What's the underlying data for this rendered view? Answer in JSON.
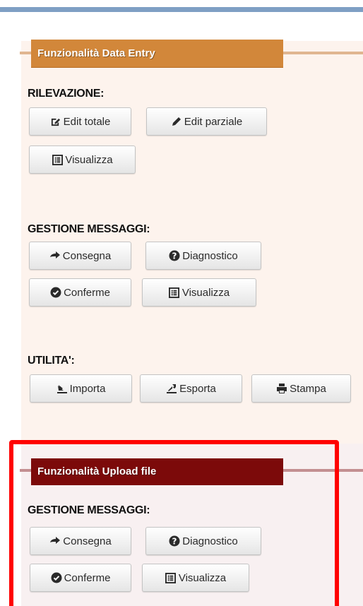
{
  "data_entry": {
    "tab_title": "Funzionalità Data Entry",
    "rilevazione": {
      "title": "RILEVAZIONE:",
      "edit_totale": "Edit totale",
      "edit_parziale": "Edit parziale",
      "visualizza": "Visualizza"
    },
    "gestione_messaggi": {
      "title": "GESTIONE MESSAGGI:",
      "consegna": "Consegna",
      "diagnostico": "Diagnostico",
      "conferme": "Conferme",
      "visualizza": "Visualizza"
    },
    "utilita": {
      "title": "UTILITA':",
      "importa": "Importa",
      "esporta": "Esporta",
      "stampa": "Stampa"
    }
  },
  "upload_file": {
    "tab_title": "Funzionalità Upload file",
    "gestione_messaggi": {
      "title": "GESTIONE MESSAGGI:",
      "consegna": "Consegna",
      "diagnostico": "Diagnostico",
      "conferme": "Conferme",
      "visualizza": "Visualizza"
    }
  },
  "colors": {
    "top_bar": "#7f9fc4",
    "data_entry_tab": "#d2873a",
    "upload_tab": "#7c0a0a",
    "highlight": "#ff0000"
  }
}
